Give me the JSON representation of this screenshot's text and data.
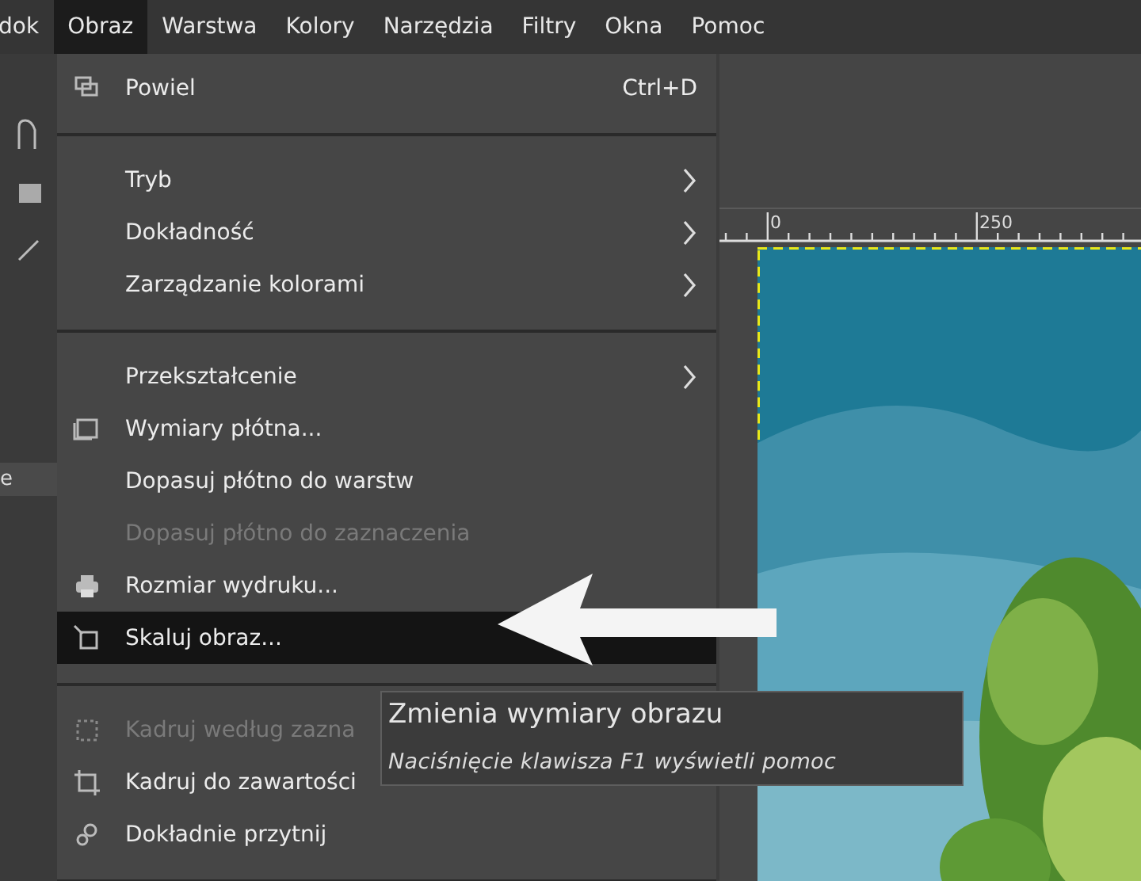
{
  "menubar": [
    {
      "label": "dok",
      "selected": false
    },
    {
      "label": "Obraz",
      "selected": true
    },
    {
      "label": "Warstwa",
      "selected": false
    },
    {
      "label": "Kolory",
      "selected": false
    },
    {
      "label": "Narzędzia",
      "selected": false
    },
    {
      "label": "Filtry",
      "selected": false
    },
    {
      "label": "Okna",
      "selected": false
    },
    {
      "label": "Pomoc",
      "selected": false
    }
  ],
  "left_panel_text": "e",
  "menu": {
    "items": [
      {
        "kind": "item",
        "label": "Powiel",
        "shortcut": "Ctrl+D",
        "submenu": false,
        "disabled": false,
        "selected": false
      },
      {
        "kind": "separator"
      },
      {
        "kind": "item",
        "label": "Tryb",
        "submenu": true,
        "disabled": false,
        "selected": false
      },
      {
        "kind": "item",
        "label": "Dokładność",
        "submenu": true,
        "disabled": false,
        "selected": false
      },
      {
        "kind": "item",
        "label": "Zarządzanie kolorami",
        "submenu": true,
        "disabled": false,
        "selected": false
      },
      {
        "kind": "separator"
      },
      {
        "kind": "item",
        "label": "Przekształcenie",
        "submenu": true,
        "disabled": false,
        "selected": false
      },
      {
        "kind": "item",
        "label": "Wymiary płótna...",
        "submenu": false,
        "disabled": false,
        "selected": false
      },
      {
        "kind": "item",
        "label": "Dopasuj płótno do warstw",
        "submenu": false,
        "disabled": false,
        "selected": false
      },
      {
        "kind": "item",
        "label": "Dopasuj płótno do zaznaczenia",
        "submenu": false,
        "disabled": true,
        "selected": false
      },
      {
        "kind": "item",
        "label": "Rozmiar wydruku...",
        "submenu": false,
        "disabled": false,
        "selected": false
      },
      {
        "kind": "item",
        "label": "Skaluj obraz...",
        "submenu": false,
        "disabled": false,
        "selected": true
      },
      {
        "kind": "separator"
      },
      {
        "kind": "item",
        "label": "Kadruj według zazna",
        "submenu": false,
        "disabled": true,
        "selected": false
      },
      {
        "kind": "item",
        "label": "Kadruj do zawartości",
        "submenu": false,
        "disabled": false,
        "selected": false
      },
      {
        "kind": "item",
        "label": "Dokładnie przytnij",
        "submenu": false,
        "disabled": false,
        "selected": false
      },
      {
        "kind": "separator"
      }
    ]
  },
  "ruler": {
    "labels": [
      "0",
      "250"
    ]
  },
  "tooltip": {
    "title": "Zmienia wymiary obrazu",
    "hint": "Naciśnięcie klawisza F1 wyświetli pomoc"
  }
}
